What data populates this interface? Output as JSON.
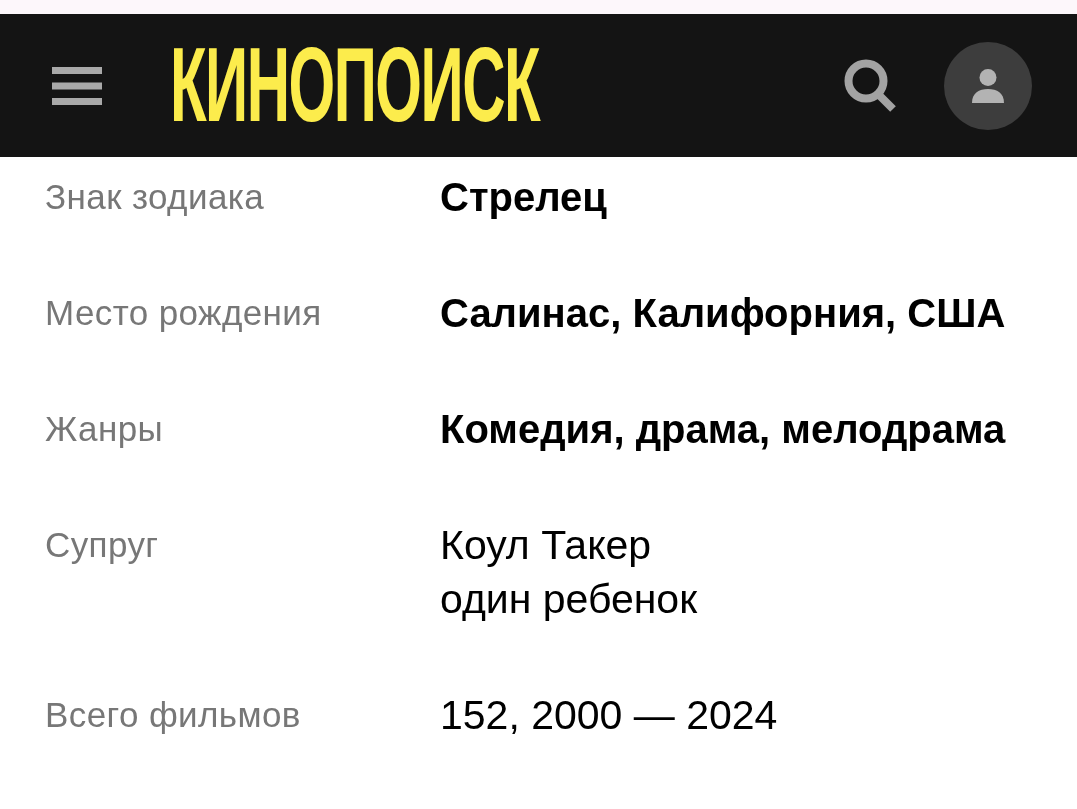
{
  "header": {
    "logo": "КИНОПОИСК"
  },
  "facts": [
    {
      "label": "Знак зодиака",
      "values": [
        "Стрелец"
      ],
      "bold": true
    },
    {
      "label": "Место рождения",
      "values": [
        "Салинас, Калифорния, США"
      ],
      "bold": true
    },
    {
      "label": "Жанры",
      "values": [
        "Комедия, драма, мелодрама"
      ],
      "bold": true
    },
    {
      "label": "Супруг",
      "values": [
        "Коул Такер",
        "один ребенок"
      ],
      "bold": false
    },
    {
      "label": "Всего фильмов",
      "values": [
        "152, 2000 — 2024"
      ],
      "bold": false
    }
  ]
}
